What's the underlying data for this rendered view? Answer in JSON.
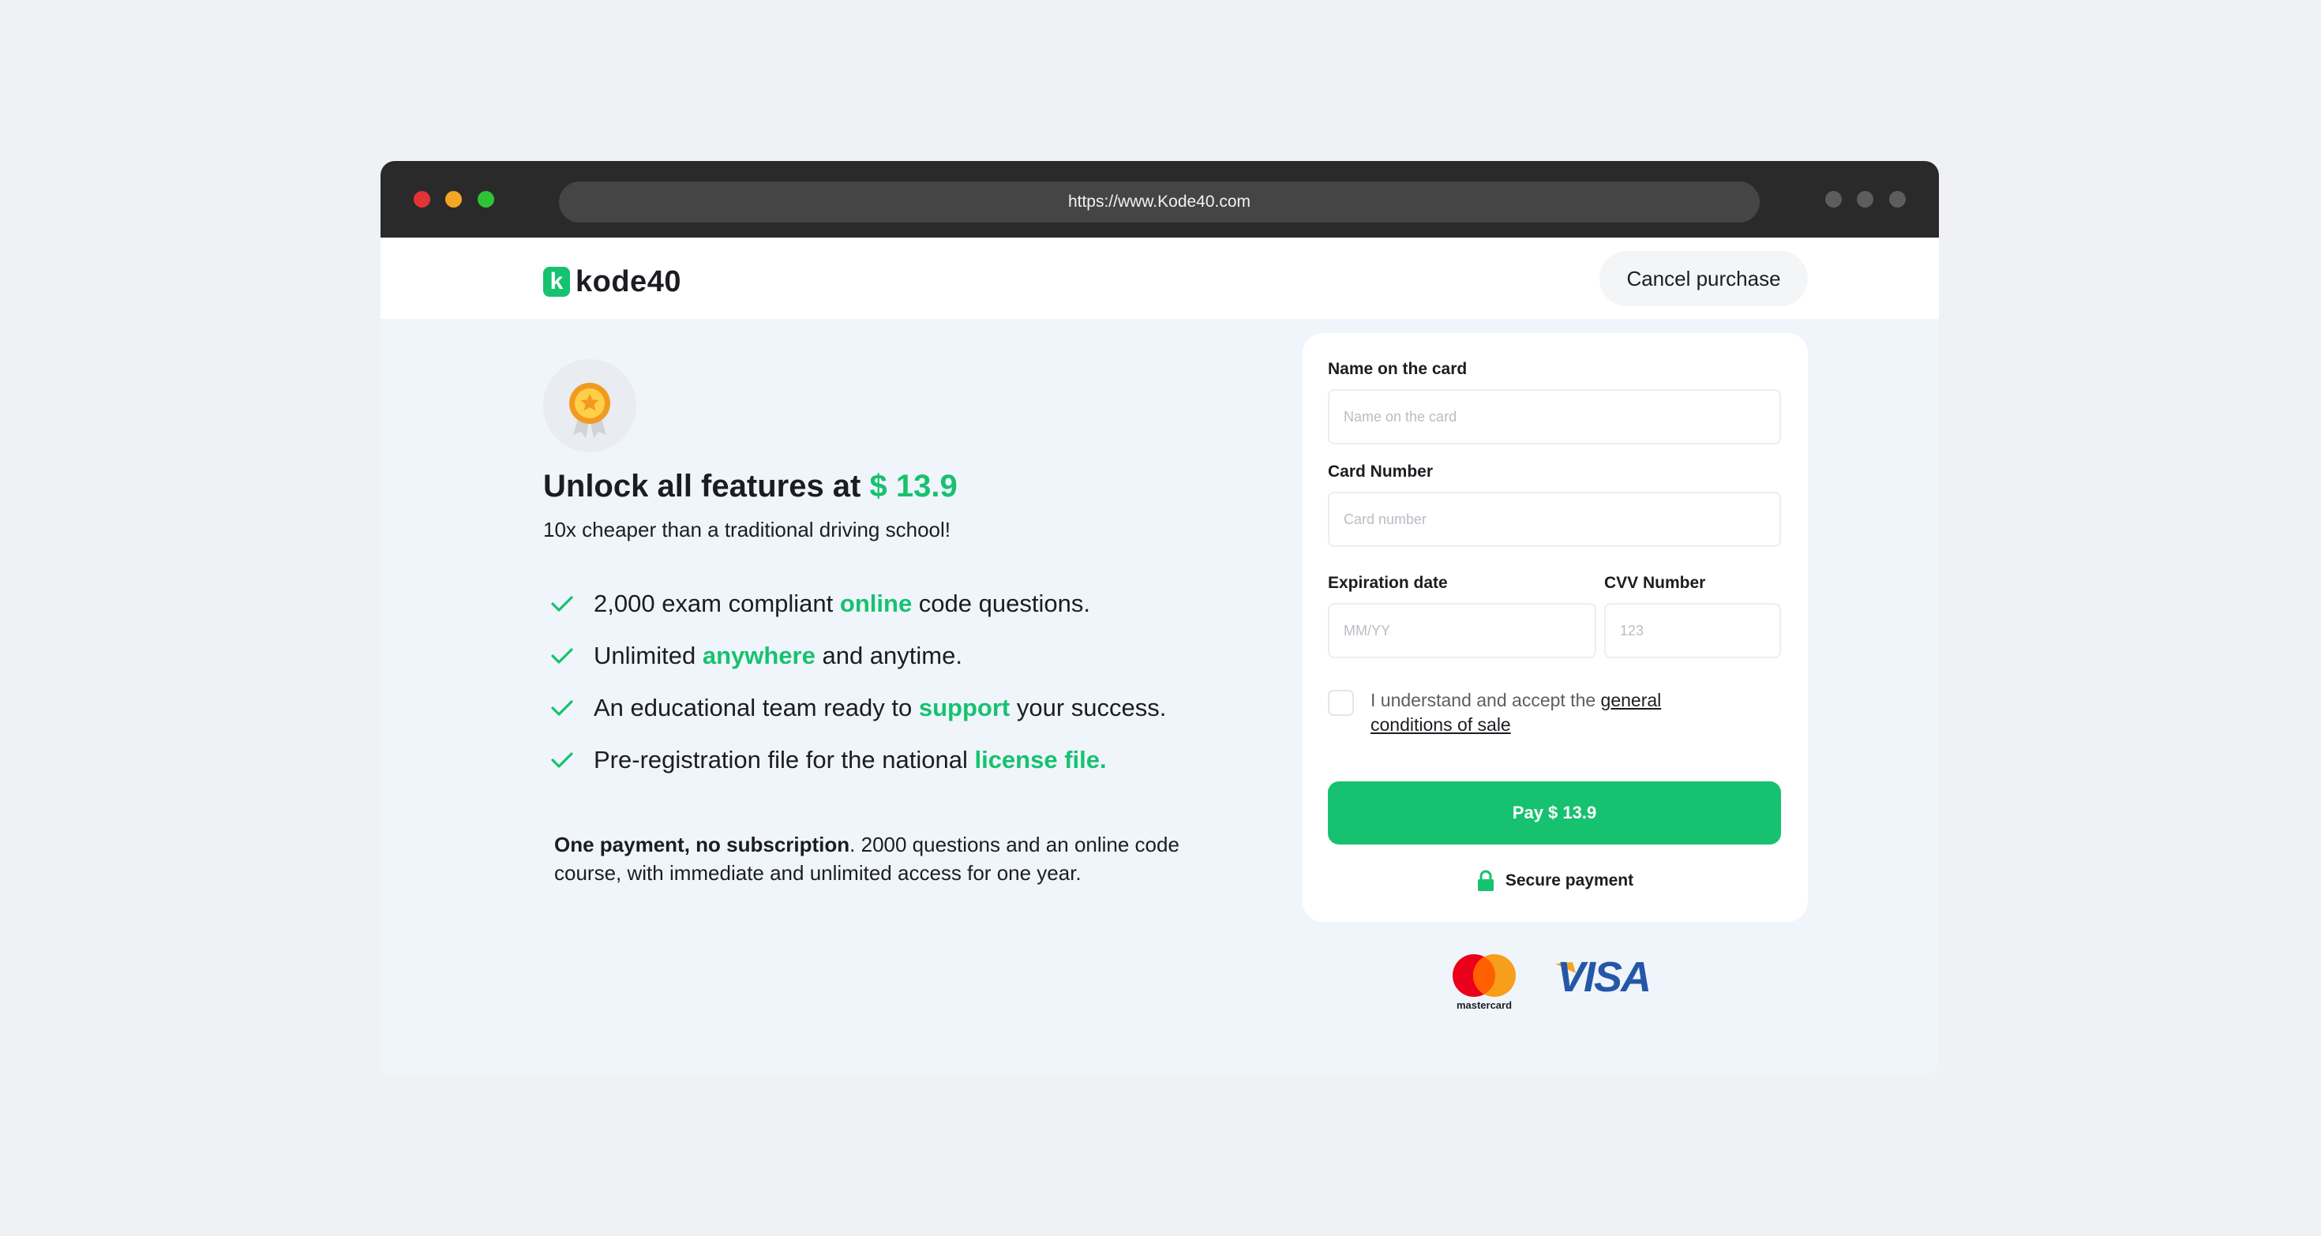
{
  "browser": {
    "url": "https://www.Kode40.com"
  },
  "header": {
    "logo_badge": "k",
    "logo_text": "kode40",
    "cancel_label": "Cancel purchase"
  },
  "hero": {
    "headline": "Unlock all features at ",
    "price": "$ 13.9",
    "subline": "10x cheaper than a traditional driving school!"
  },
  "features": [
    {
      "before": "2,000 exam compliant ",
      "highlight": "online",
      "after": " code questions."
    },
    {
      "before": "Unlimited ",
      "highlight": "anywhere",
      "after": " and anytime."
    },
    {
      "before": "An educational team ready to ",
      "highlight": "support",
      "after": " your success."
    },
    {
      "before": "Pre-registration file for the national ",
      "highlight": "license file.",
      "after": ""
    }
  ],
  "note": {
    "bold": "One payment, no subscription",
    "text": ". 2000 questions and an online code course, with immediate and unlimited access for one year."
  },
  "form": {
    "name_label": "Name on the card",
    "name_placeholder": "Name on the card",
    "number_label": "Card Number",
    "number_placeholder": "Card number",
    "expiry_label": "Expiration date",
    "expiry_placeholder": "MM/YY",
    "cvv_label": "CVV Number",
    "cvv_placeholder": "123",
    "terms_text": "I understand and accept the ",
    "terms_link": "general conditions of sale",
    "pay_label": "Pay $ 13.9",
    "secure_label": "Secure payment"
  },
  "payment_logos": {
    "mastercard": "mastercard",
    "visa": "VISA"
  },
  "colors": {
    "accent": "#16c26f",
    "page_bg": "#eff1f5",
    "content_bg": "#f0f5fb",
    "chrome": "#2a2a2a"
  }
}
